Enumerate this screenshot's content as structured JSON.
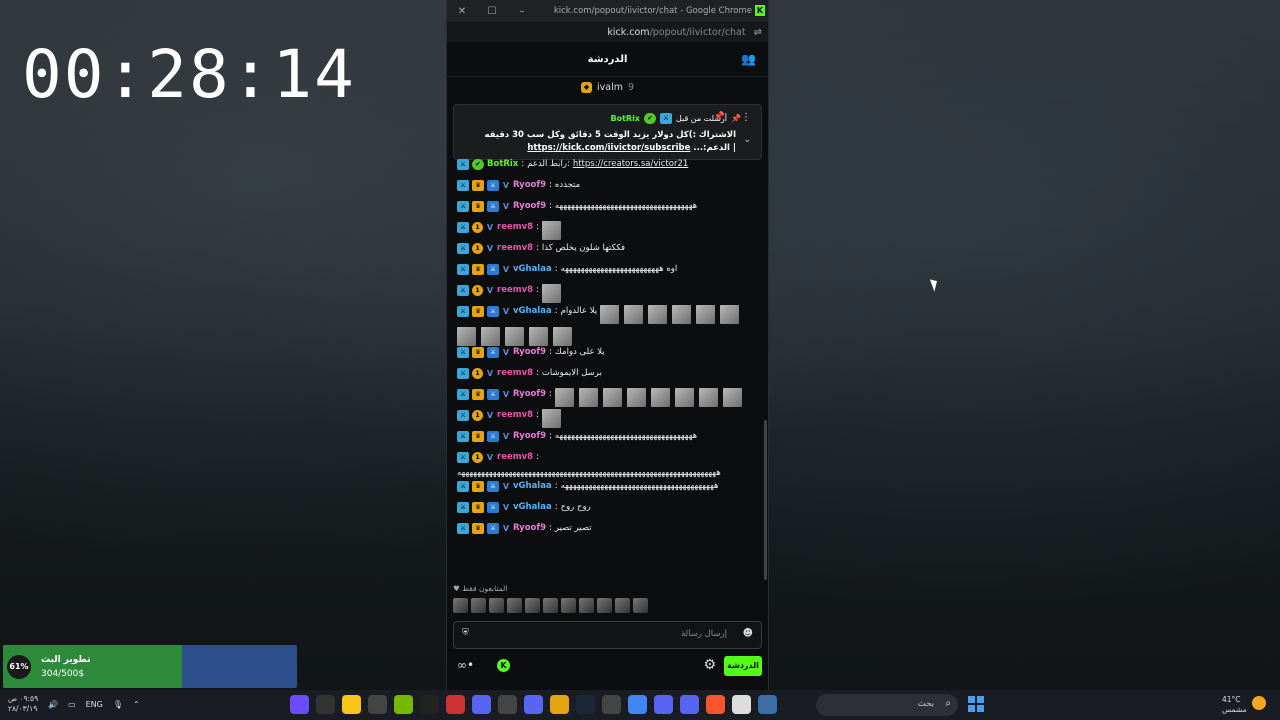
{
  "timer": "00:28:14",
  "window": {
    "title": "kick.com/popout/iivictor/chat - Google Chrome",
    "url_host": "kick.com",
    "url_path": "/popout/iivictor/chat"
  },
  "chat": {
    "header": "الدردشة",
    "pinned_top_user": "ivalm",
    "pinned_top_count": "9",
    "pinned": {
      "sent_label": "أرسلت من قبل",
      "user": "BotRix",
      "text": "الاشتراك :)كل دولار يزيد الوقت 5 دقائق وكل سب 30 دقيقه",
      "link": "https://kick.com/iivictor/subscribe",
      "suffix": "| الدعم:..."
    },
    "messages": [
      {
        "user": "BotRix",
        "color": "#53fc18",
        "text": "رابط الدعم:",
        "link": "https://creators.sa/victor21",
        "badges": [
          "sub",
          "bot"
        ]
      },
      {
        "user": "Ryoof9",
        "color": "#e87bd6",
        "text": "متجدده",
        "badges": [
          "sub",
          "crown",
          "ok",
          "v"
        ]
      },
      {
        "user": "Ryoof9",
        "color": "#e87bd6",
        "text": "هههههههههههههههههههههههههههههههههههه",
        "badges": [
          "sub",
          "crown",
          "ok",
          "v"
        ]
      },
      {
        "user": "reemv8",
        "color": "#e854b0",
        "text": "",
        "emotes": 1,
        "badges": [
          "sub",
          "coin",
          "v"
        ]
      },
      {
        "user": "reemv8",
        "color": "#e854b0",
        "text": "فككتها شلون يخلص كذا",
        "badges": [
          "sub",
          "coin",
          "v"
        ]
      },
      {
        "user": "vGhalaa",
        "color": "#4fb3ff",
        "text": "اوه هههههههههههههههههههههههههه",
        "badges": [
          "sub",
          "crown",
          "ok",
          "v"
        ]
      },
      {
        "user": "reemv8",
        "color": "#e854b0",
        "text": "",
        "emotes": 1,
        "badges": [
          "sub",
          "coin",
          "v"
        ]
      },
      {
        "user": "vGhalaa",
        "color": "#4fb3ff",
        "text": "يلا عالدوام",
        "emotes": 11,
        "badges": [
          "sub",
          "crown",
          "ok",
          "v"
        ]
      },
      {
        "user": "Ryoof9",
        "color": "#e87bd6",
        "text": "يلا على دوامك",
        "badges": [
          "sub",
          "crown",
          "ok",
          "v"
        ]
      },
      {
        "user": "reemv8",
        "color": "#e854b0",
        "text": "برسل الايموشات",
        "badges": [
          "sub",
          "coin",
          "v"
        ]
      },
      {
        "user": "Ryoof9",
        "color": "#e87bd6",
        "text": "",
        "emotes": 8,
        "badges": [
          "sub",
          "crown",
          "ok",
          "v"
        ]
      },
      {
        "user": "reemv8",
        "color": "#e854b0",
        "text": "",
        "emotes": 1,
        "badges": [
          "sub",
          "coin",
          "v"
        ]
      },
      {
        "user": "Ryoof9",
        "color": "#e87bd6",
        "text": "هههههههههههههههههههههههههههههههههههه",
        "badges": [
          "sub",
          "crown",
          "ok",
          "v"
        ]
      },
      {
        "user": "reemv8",
        "color": "#e854b0",
        "text": "ههههههههههههههههههههههههههههههههههههههههههههههههههههههههههههههههههه",
        "badges": [
          "sub",
          "coin",
          "v"
        ]
      },
      {
        "user": "vGhalaa",
        "color": "#4fb3ff",
        "text": "هههههههههههههههههههههههههههههههههههههههه",
        "badges": [
          "sub",
          "crown",
          "ok",
          "v"
        ]
      },
      {
        "user": "vGhalaa",
        "color": "#4fb3ff",
        "text": "روح روح",
        "badges": [
          "sub",
          "crown",
          "ok",
          "v"
        ]
      },
      {
        "user": "Ryoof9",
        "color": "#e87bd6",
        "text": "تصير تصير",
        "badges": [
          "sub",
          "crown",
          "ok",
          "v"
        ]
      }
    ],
    "supporters_label": "المتابعون فقط",
    "input_placeholder": "إرسال رسالة",
    "chat_button": "الدردشة"
  },
  "goal": {
    "title": "تطوير البث",
    "value": "304/500$",
    "percent_label": "61%",
    "fraction": 0.61
  },
  "taskbar": {
    "time": "٠٩:٥٩ ص",
    "date": "٢٨/٠٣/١٩",
    "lang": "ENG",
    "search_placeholder": "بحث",
    "weather_temp": "41°C",
    "weather_desc": "مشمس"
  }
}
